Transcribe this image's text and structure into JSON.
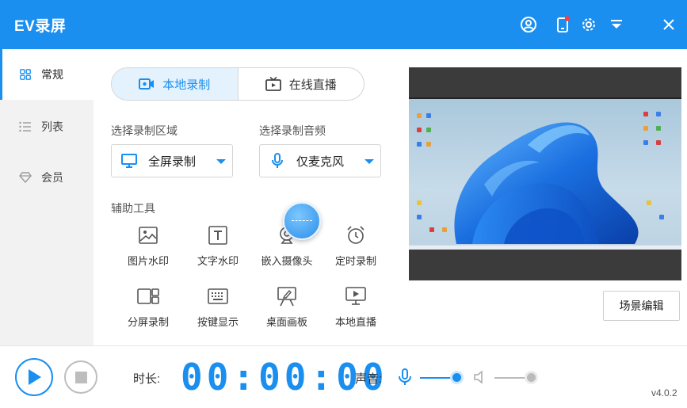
{
  "app": {
    "title": "EV录屏"
  },
  "sidebar": {
    "items": [
      {
        "label": "常规",
        "icon": "grid-icon"
      },
      {
        "label": "列表",
        "icon": "list-icon"
      },
      {
        "label": "会员",
        "icon": "diamond-icon"
      }
    ]
  },
  "mode_tabs": [
    {
      "label": "本地录制",
      "icon": "record-icon"
    },
    {
      "label": "在线直播",
      "icon": "tv-icon"
    }
  ],
  "record_area": {
    "label": "选择录制区域",
    "value": "全屏录制",
    "icon": "monitor-icon"
  },
  "record_audio": {
    "label": "选择录制音频",
    "value": "仅麦克风",
    "icon": "microphone-icon"
  },
  "tools": {
    "label": "辅助工具",
    "items": [
      {
        "label": "图片水印",
        "icon": "image-icon"
      },
      {
        "label": "文字水印",
        "icon": "text-icon"
      },
      {
        "label": "嵌入摄像头",
        "icon": "webcam-icon"
      },
      {
        "label": "定时录制",
        "icon": "alarm-icon"
      },
      {
        "label": "分屏录制",
        "icon": "split-screen-icon"
      },
      {
        "label": "按键显示",
        "icon": "keyboard-icon"
      },
      {
        "label": "桌面画板",
        "icon": "easel-icon"
      },
      {
        "label": "本地直播",
        "icon": "screen-play-icon"
      }
    ]
  },
  "scene_edit": "场景编辑",
  "bottom": {
    "duration_label": "时长:",
    "timer": {
      "h": "00",
      "m": "00",
      "s": "00",
      "sep": ":"
    },
    "volume_label": "声音:",
    "mic_volume": 0.9,
    "speaker_volume": 0.9,
    "version": "v4.0.2"
  },
  "colors": {
    "accent": "#1a8ff0",
    "titlebar": "#1a8ff0",
    "sidebar_bg": "#f2f2f2"
  }
}
